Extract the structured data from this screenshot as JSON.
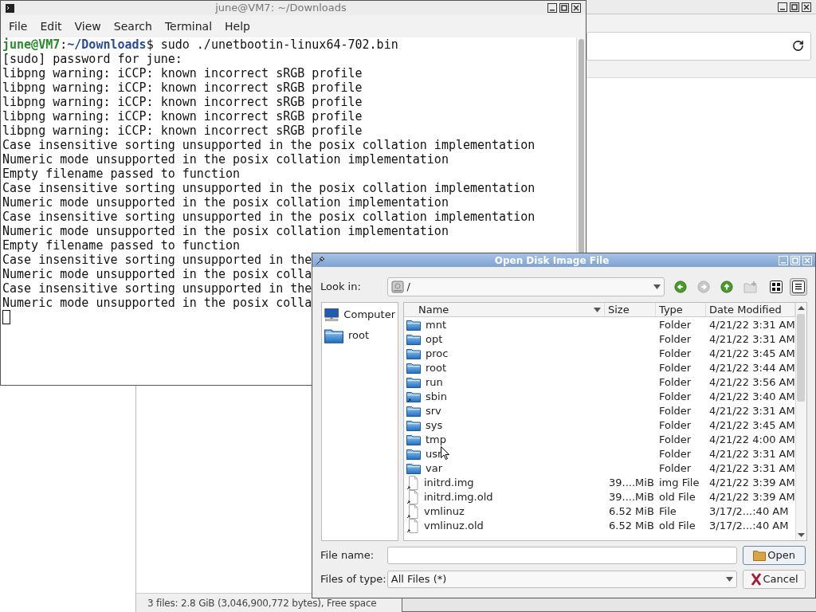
{
  "background_window": {
    "status_bar": "3 files: 2.8 GiB (3,046,900,772 bytes), Free space"
  },
  "terminal": {
    "title": "june@VM7: ~/Downloads",
    "menu": [
      "File",
      "Edit",
      "View",
      "Search",
      "Terminal",
      "Help"
    ],
    "prompt": {
      "user_host": "june@VM7",
      "separator": ":",
      "path": "~/Downloads",
      "command": "$ sudo ./unetbootin-linux64-702.bin"
    },
    "lines": [
      "[sudo] password for june:",
      "libpng warning: iCCP: known incorrect sRGB profile",
      "libpng warning: iCCP: known incorrect sRGB profile",
      "libpng warning: iCCP: known incorrect sRGB profile",
      "libpng warning: iCCP: known incorrect sRGB profile",
      "libpng warning: iCCP: known incorrect sRGB profile",
      "Case insensitive sorting unsupported in the posix collation implementation",
      "Numeric mode unsupported in the posix collation implementation",
      "Empty filename passed to function",
      "Case insensitive sorting unsupported in the posix collation implementation",
      "Numeric mode unsupported in the posix collation implementation",
      "Case insensitive sorting unsupported in the posix collation implementation",
      "Numeric mode unsupported in the posix collation implementation",
      "Empty filename passed to function",
      "Case insensitive sorting unsupported in the",
      "Numeric mode unsupported in the posix colla",
      "Case insensitive sorting unsupported in the",
      "Numeric mode unsupported in the posix colla"
    ]
  },
  "dialog": {
    "title": "Open Disk Image File",
    "look_in_label": "Look in:",
    "look_in_value": "/",
    "nav_buttons": [
      {
        "kind": "back",
        "disabled": false
      },
      {
        "kind": "forward",
        "disabled": true
      },
      {
        "kind": "up",
        "disabled": false
      },
      {
        "kind": "new_folder",
        "disabled": true
      }
    ],
    "view_buttons": [
      {
        "kind": "list",
        "selected": false
      },
      {
        "kind": "detail",
        "selected": true
      }
    ],
    "places": [
      {
        "label": "Computer",
        "kind": "computer"
      },
      {
        "label": "root",
        "kind": "folder"
      }
    ],
    "columns": [
      "Name",
      "Size",
      "Type",
      "Date Modified"
    ],
    "rows": [
      {
        "name": "mnt",
        "size": "",
        "type": "Folder",
        "date": "4/21/22 3:31 AM",
        "kind": "folder"
      },
      {
        "name": "opt",
        "size": "",
        "type": "Folder",
        "date": "4/21/22 3:31 AM",
        "kind": "folder"
      },
      {
        "name": "proc",
        "size": "",
        "type": "Folder",
        "date": "4/21/22 3:45 AM",
        "kind": "folder"
      },
      {
        "name": "root",
        "size": "",
        "type": "Folder",
        "date": "4/21/22 3:44 AM",
        "kind": "folder"
      },
      {
        "name": "run",
        "size": "",
        "type": "Folder",
        "date": "4/21/22 3:56 AM",
        "kind": "folder"
      },
      {
        "name": "sbin",
        "size": "",
        "type": "Folder",
        "date": "4/21/22 3:40 AM",
        "kind": "folder_link"
      },
      {
        "name": "srv",
        "size": "",
        "type": "Folder",
        "date": "4/21/22 3:31 AM",
        "kind": "folder"
      },
      {
        "name": "sys",
        "size": "",
        "type": "Folder",
        "date": "4/21/22 3:45 AM",
        "kind": "folder"
      },
      {
        "name": "tmp",
        "size": "",
        "type": "Folder",
        "date": "4/21/22 4:00 AM",
        "kind": "folder"
      },
      {
        "name": "usr",
        "size": "",
        "type": "Folder",
        "date": "4/21/22 3:31 AM",
        "kind": "folder"
      },
      {
        "name": "var",
        "size": "",
        "type": "Folder",
        "date": "4/21/22 3:31 AM",
        "kind": "folder"
      },
      {
        "name": "initrd.img",
        "size": "39....MiB",
        "type": "img File",
        "date": "4/21/22 3:39 AM",
        "kind": "file_link"
      },
      {
        "name": "initrd.img.old",
        "size": "39....MiB",
        "type": "old File",
        "date": "4/21/22 3:39 AM",
        "kind": "file_link"
      },
      {
        "name": "vmlinuz",
        "size": "6.52 MiB",
        "type": "File",
        "date": "3/17/2...:40 AM",
        "kind": "file_link"
      },
      {
        "name": "vmlinuz.old",
        "size": "6.52 MiB",
        "type": "old File",
        "date": "3/17/2...:40 AM",
        "kind": "file_link"
      }
    ],
    "file_name_label": "File name:",
    "file_type_label": "Files of type:",
    "file_type": "All Files (*)",
    "buttons": [
      {
        "label": "Open",
        "kind": "open"
      },
      {
        "label": "Cancel",
        "kind": "cancel"
      }
    ]
  }
}
